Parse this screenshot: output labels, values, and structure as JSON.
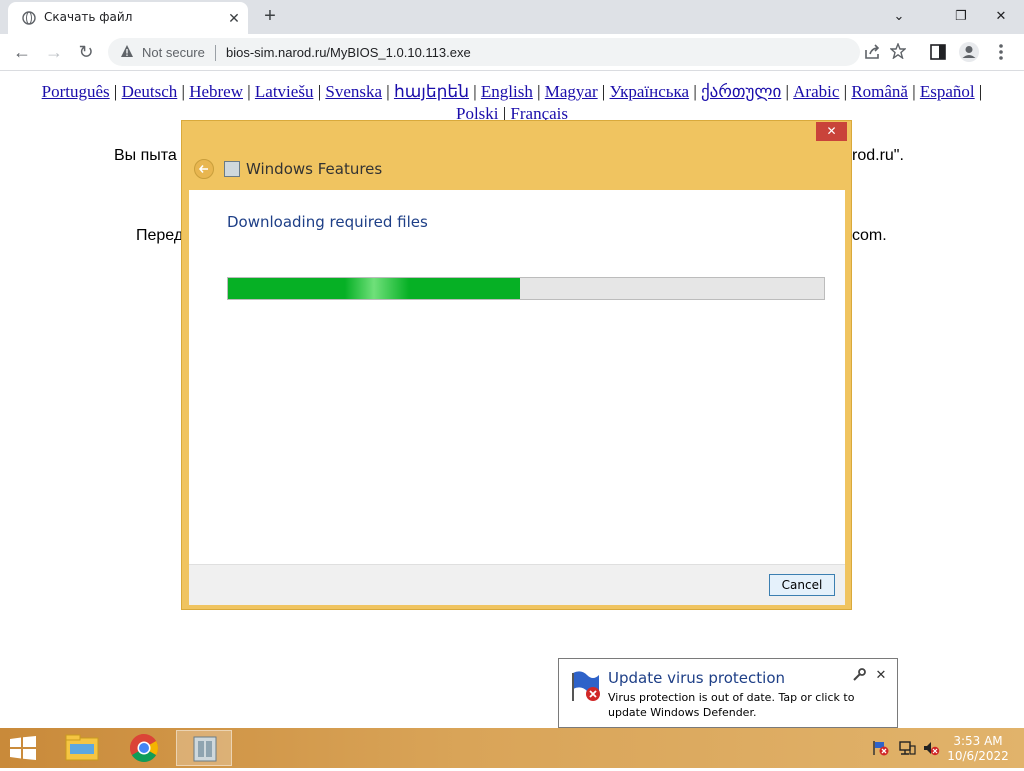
{
  "browser": {
    "tab_title": "Скачать файл",
    "tab_close": "✕",
    "new_tab": "+",
    "window_controls": {
      "minimize": "⌄",
      "restore": "❐",
      "close": "✕"
    },
    "nav": {
      "back": "←",
      "forward": "→",
      "reload": "↻"
    },
    "security_label": "Not secure",
    "url": "bios-sim.narod.ru/MyBIOS_1.0.10.113.exe",
    "icons": [
      "share-icon",
      "star-icon",
      "sidebar-icon",
      "profile-icon",
      "menu-icon"
    ]
  },
  "page": {
    "languages": [
      "Português",
      "Deutsch",
      "Hebrew",
      "Latviešu",
      "Svenska",
      "հայերեն",
      "English",
      "Magyar",
      "Українська",
      "ქართული",
      "Arabic",
      "Română",
      "Español",
      "Polski",
      "Français"
    ],
    "separator": "|",
    "line1_left": "Вы пыта",
    "line1_right": "rod.ru\".",
    "line2_left": "Перед",
    "line2_right": "com."
  },
  "dialog": {
    "title": "Windows Features",
    "close": "✕",
    "heading": "Downloading required files",
    "progress_fraction": 0.49,
    "cancel_label": "Cancel",
    "accent_color": "#f0c460"
  },
  "toast": {
    "title": "Update virus protection",
    "message": "Virus protection is out of date. Tap or click to update Windows Defender.",
    "close": "✕"
  },
  "taskbar": {
    "apps": [
      "file-explorer",
      "chrome",
      "windows-features"
    ],
    "time": "3:53 AM",
    "date": "10/6/2022"
  }
}
